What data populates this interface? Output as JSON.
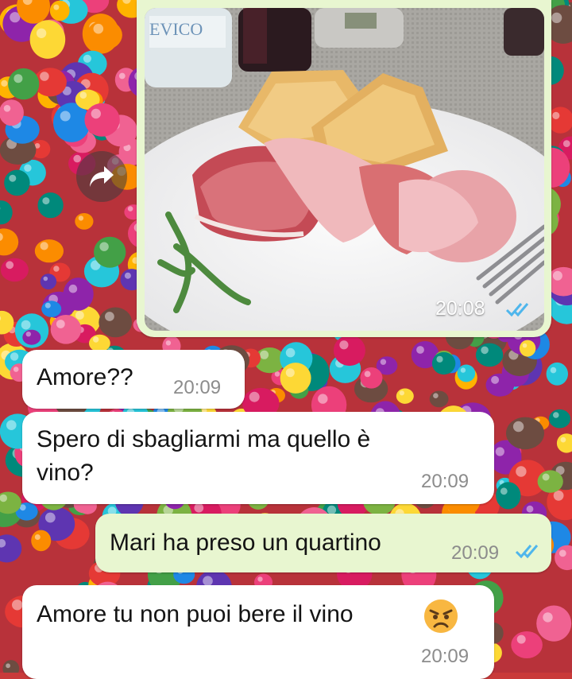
{
  "chat": {
    "messages": [
      {
        "type": "image",
        "direction": "outgoing",
        "time": "20:08",
        "status": "read",
        "image_content": "Plate with ham, prosciutto and fried dough, wine glass and water bottle",
        "image_label": "EVICO"
      },
      {
        "type": "text",
        "direction": "incoming",
        "text": "Amore??",
        "time": "20:09"
      },
      {
        "type": "text",
        "direction": "incoming",
        "text": "Spero di sbagliarmi ma quello è\nvino?",
        "time": "20:09"
      },
      {
        "type": "text",
        "direction": "outgoing",
        "text": "Mari ha preso un quartino",
        "time": "20:09",
        "status": "read"
      },
      {
        "type": "text",
        "direction": "incoming",
        "text": "Amore tu non puoi bere il vino",
        "emoji": "angry-face",
        "time": "20:09"
      }
    ]
  },
  "icons": {
    "forward": "forward-arrow-icon",
    "read_receipt": "double-check-icon",
    "emoji": "angry-face-icon"
  },
  "colors": {
    "incoming_bubble": "#ffffff",
    "outgoing_bubble": "#e8f6d0",
    "read_tick": "#4fb6ec",
    "timestamp": "#8c8c8c",
    "text": "#141414"
  }
}
